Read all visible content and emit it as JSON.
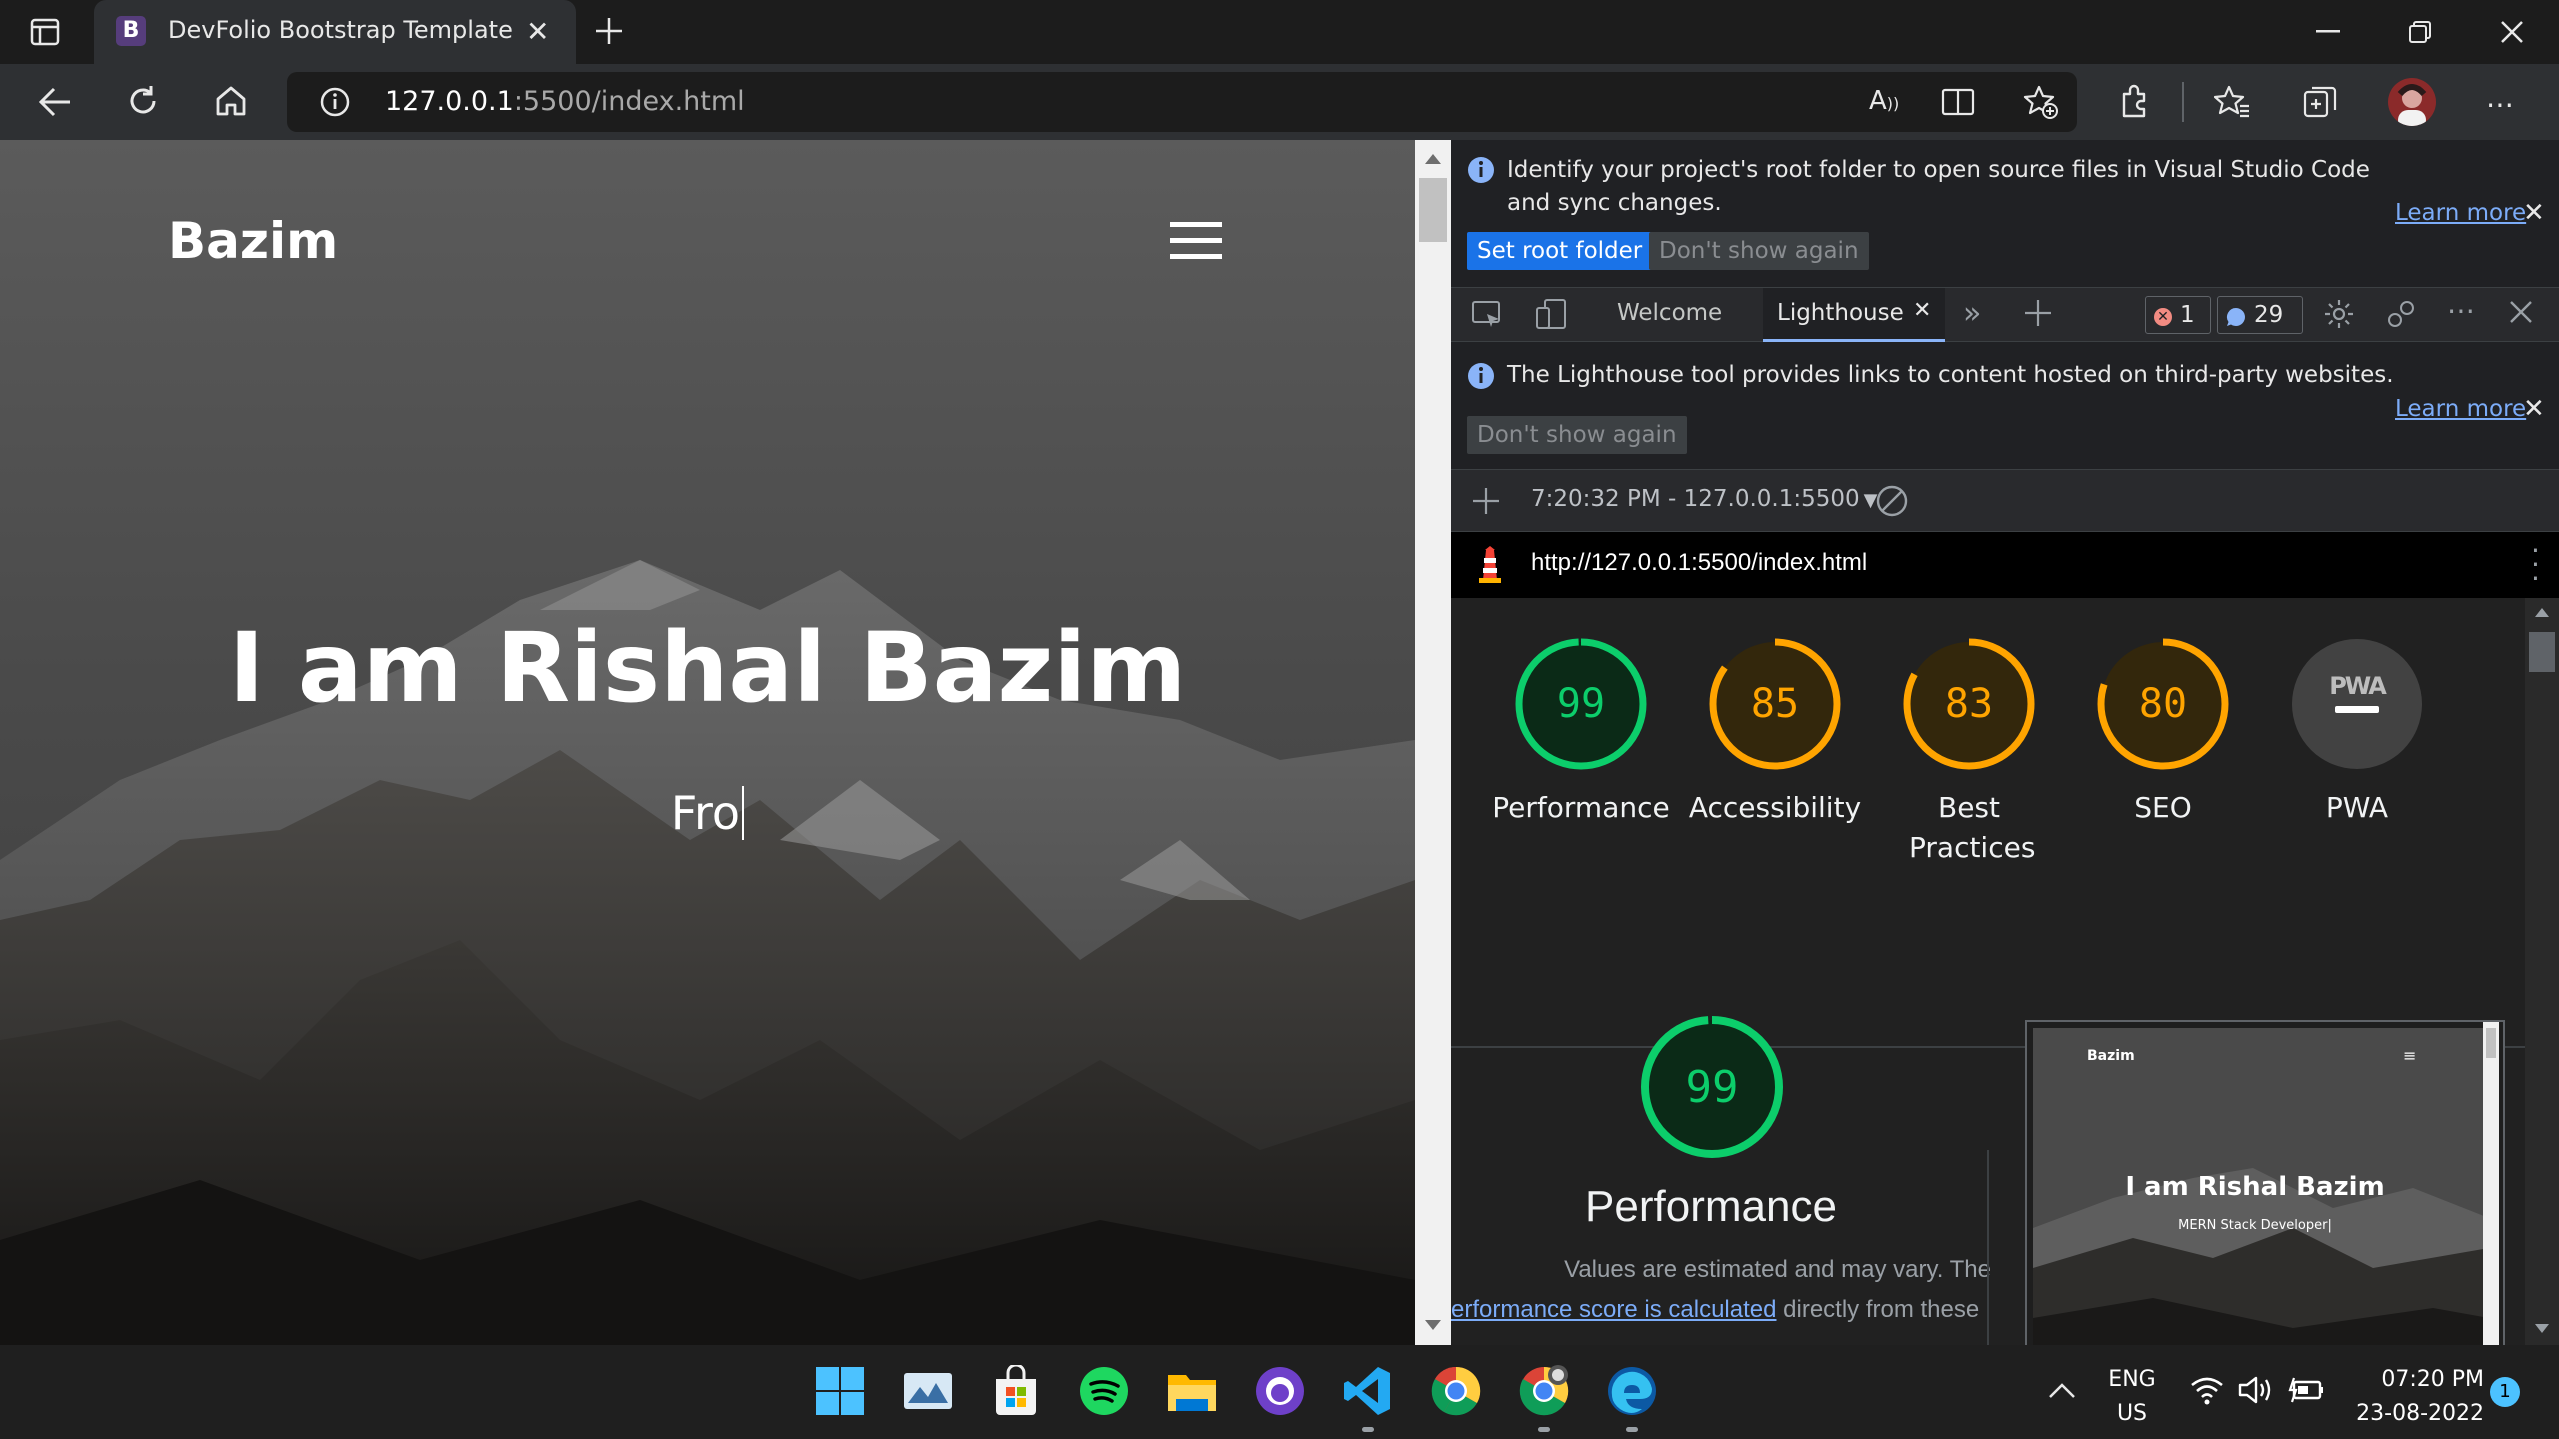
{
  "browser": {
    "tab": {
      "favicon_letter": "B",
      "title": "DevFolio Bootstrap Template"
    },
    "address": {
      "host": "127.0.0.1",
      "path": ":5500/index.html"
    }
  },
  "site": {
    "brand": "Bazim",
    "hero_title": "I am Rishal Bazim",
    "hero_typed": "Fro"
  },
  "devtools": {
    "infobar": {
      "message": "Identify your project's root folder to open source files in Visual Studio Code and sync changes.",
      "learn_more": "Learn more",
      "set_root": "Set root folder",
      "dont_show": "Don't show again"
    },
    "tabs": [
      {
        "label": "Welcome"
      },
      {
        "label": "Lighthouse"
      }
    ],
    "errors_count": "1",
    "messages_count": "29",
    "lh_notice": {
      "message": "The Lighthouse tool provides links to content hosted on third-party websites.",
      "learn_more": "Learn more",
      "dont_show": "Don't show again"
    },
    "report_select": "7:20:32 PM - 127.0.0.1:5500",
    "report_url": "http://127.0.0.1:5500/index.html",
    "scores": [
      {
        "value": "99",
        "label": "Performance",
        "color": "#0cce6b"
      },
      {
        "value": "85",
        "label": "Accessibility",
        "color": "#ffa400"
      },
      {
        "value": "83",
        "label": "Best Practices",
        "color": "#ffa400"
      },
      {
        "value": "80",
        "label": "SEO",
        "color": "#ffa400"
      },
      {
        "value": "PWA",
        "label": "PWA",
        "color": "#9aa0a6"
      }
    ],
    "perf": {
      "score": "99",
      "title": "Performance",
      "desc_1": "Values are estimated and may vary. The",
      "desc_link": "erformance score is calculated",
      "desc_2": "directly from these"
    },
    "thumbnail": {
      "brand": "Bazim",
      "title": "I am Rishal Bazim",
      "subtitle": "MERN Stack Developer|"
    }
  },
  "system_tray": {
    "lang_1": "ENG",
    "lang_2": "US",
    "time": "07:20 PM",
    "date": "23-08-2022",
    "notification_count": "1"
  }
}
